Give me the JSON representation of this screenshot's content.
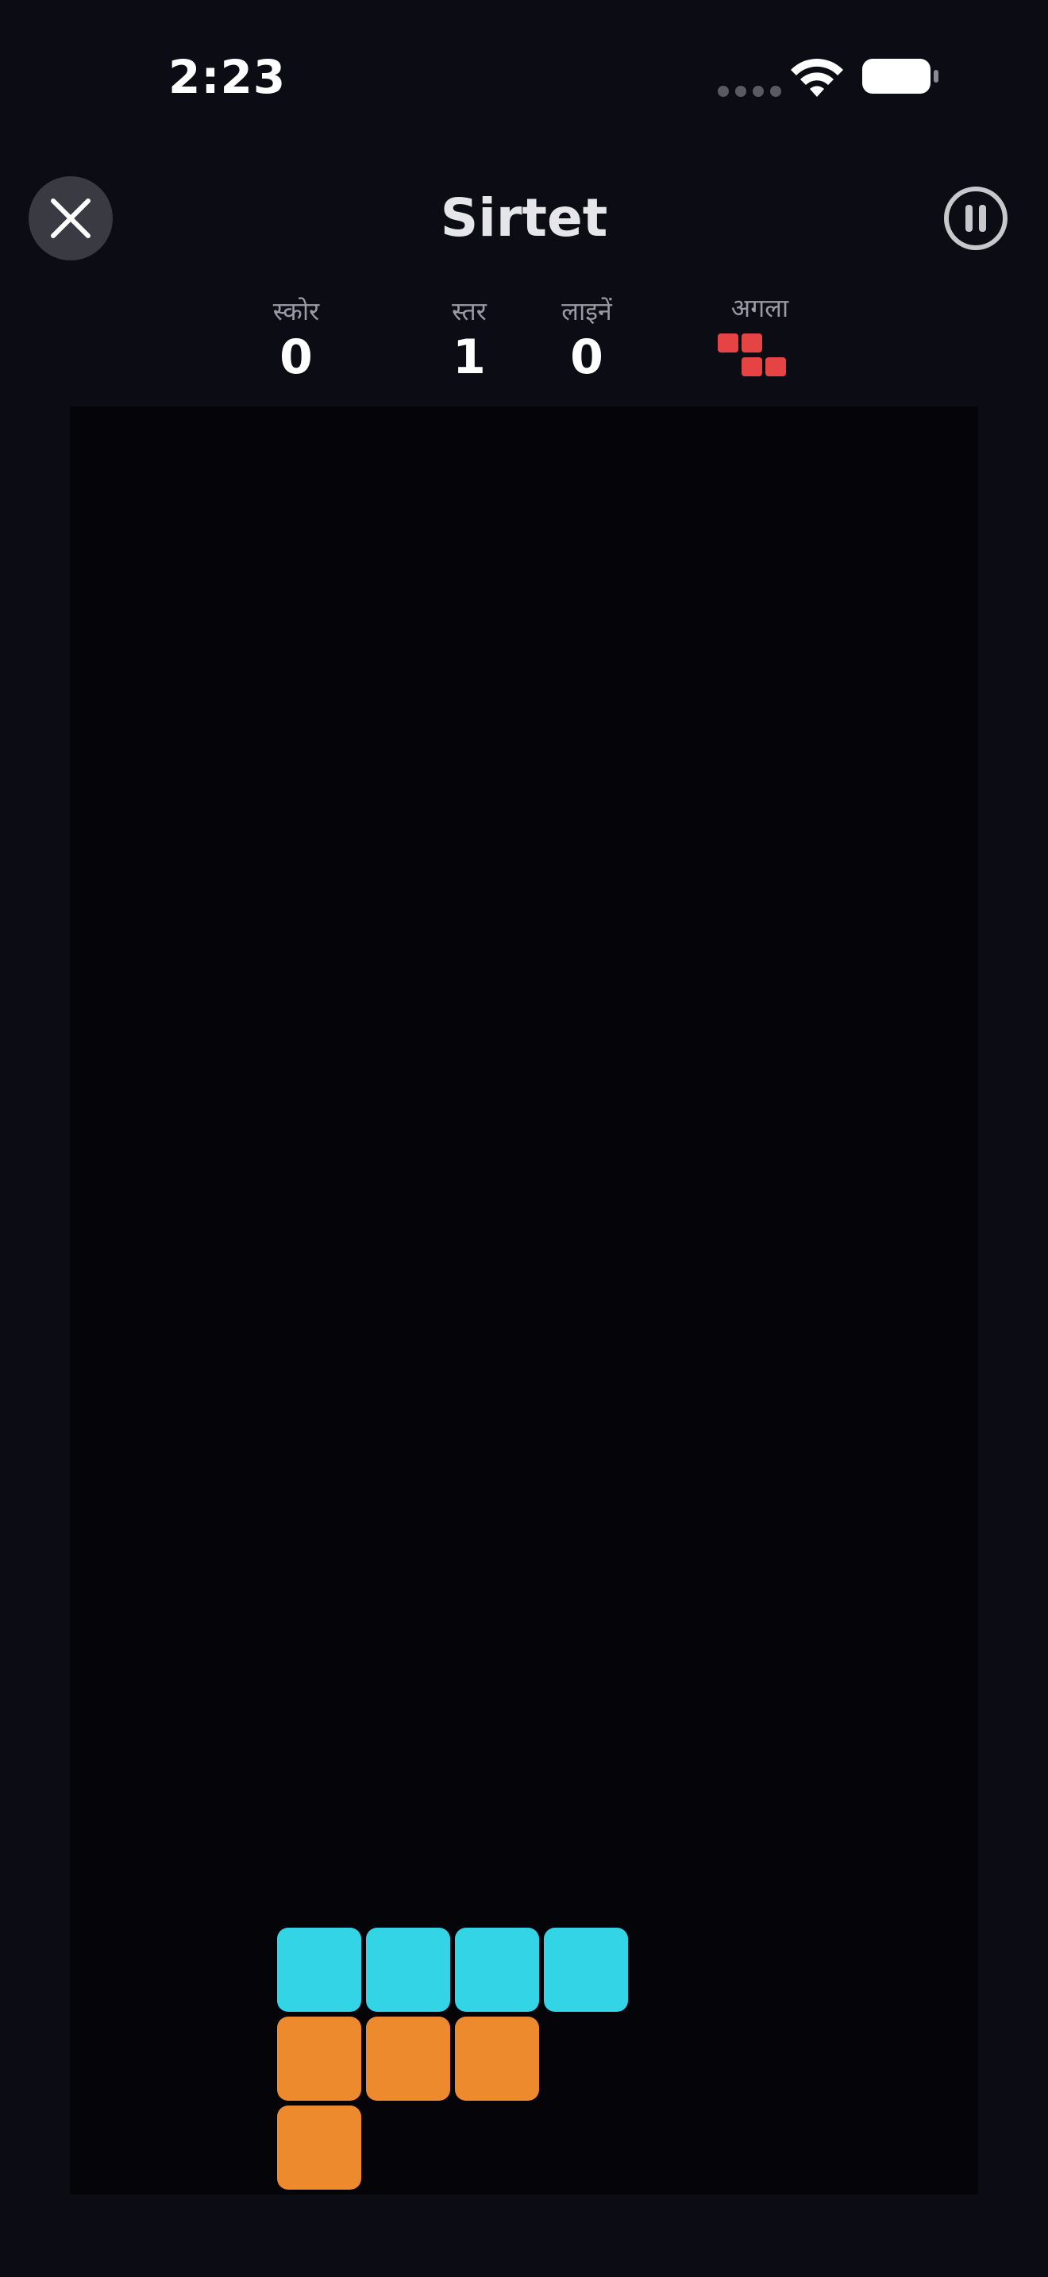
{
  "status_bar": {
    "time": "2:23",
    "wifi_icon": "wifi-icon",
    "battery_icon": "battery-icon"
  },
  "header": {
    "title": "Sirtet",
    "close_icon": "close-icon",
    "pause_icon": "pause-icon"
  },
  "stats": {
    "score_label": "स्कोर",
    "score_value": "0",
    "level_label": "स्तर",
    "level_value": "1",
    "lines_label": "लाइनें",
    "lines_value": "0",
    "next_label": "अगला"
  },
  "next_piece": {
    "shape": "Z",
    "color": "#e64444",
    "cells": [
      [
        0,
        0
      ],
      [
        0,
        1
      ],
      [
        1,
        1
      ],
      [
        1,
        2
      ]
    ]
  },
  "board": {
    "columns": 10,
    "background": "#050509",
    "blocks": [
      {
        "row": 0,
        "col": 3,
        "color": "#33d4e6",
        "piece": "I"
      },
      {
        "row": 0,
        "col": 4,
        "color": "#33d4e6",
        "piece": "I"
      },
      {
        "row": 0,
        "col": 5,
        "color": "#33d4e6",
        "piece": "I"
      },
      {
        "row": 0,
        "col": 6,
        "color": "#33d4e6",
        "piece": "I"
      },
      {
        "row": 1,
        "col": 3,
        "color": "#ee8a2e",
        "piece": "L"
      },
      {
        "row": 1,
        "col": 4,
        "color": "#ee8a2e",
        "piece": "L"
      },
      {
        "row": 1,
        "col": 5,
        "color": "#ee8a2e",
        "piece": "L"
      },
      {
        "row": 2,
        "col": 3,
        "color": "#ee8a2e",
        "piece": "L"
      }
    ]
  }
}
